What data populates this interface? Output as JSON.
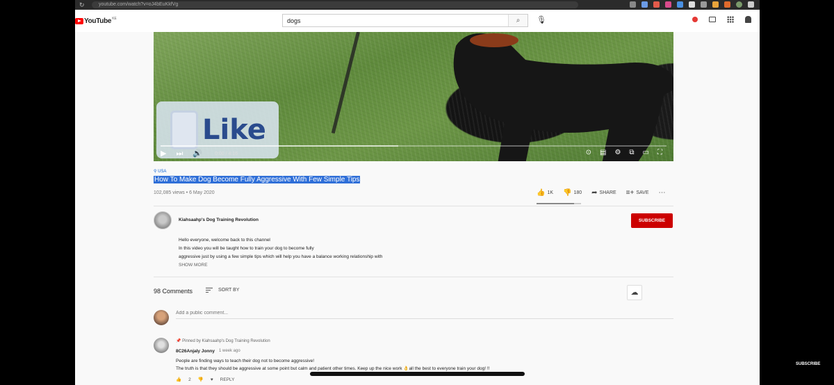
{
  "browser": {
    "url": "youtube.com/watch?v=oJ4bEuKkfVg"
  },
  "header": {
    "logo": "YouTube",
    "region": "KE",
    "search_value": "dogs",
    "search_placeholder": "Search"
  },
  "player": {
    "overlay_text": "Like",
    "time": "0:00 / 4:16",
    "progress_fraction": 0.0,
    "loaded_fraction": 0.47
  },
  "video": {
    "location": "USA",
    "title": "How To Make Dog Become Fully Aggressive With Few Simple Tips",
    "meta": "102,085 views • 6 May 2020",
    "likes": "1K",
    "dislikes": "180",
    "share_label": "SHARE",
    "save_label": "SAVE"
  },
  "channel": {
    "name": "Kiahsaahp's Dog Training Revolution",
    "subscribe_label": "SUBSCRIBE"
  },
  "description": {
    "line1": "Hello everyone, welcome back to this channel",
    "line2": "In this video you will be taught how to train your dog to become fully",
    "line3": "aggressive just by using a few simple tips which will help you have a balance working relationship with",
    "show_more": "SHOW MORE"
  },
  "comments": {
    "count_label": "98 Comments",
    "sort_label": "SORT BY",
    "add_placeholder": "Add a public comment...",
    "pinned_label": "Pinned by Kiahsaahp's Dog Training Revolution",
    "author": "8C26Anjaly Jonny",
    "time": "1 week ago",
    "text_line1": "People are finding ways to teach their dog not to become aggressive!",
    "text_line2": "The truth is that they should be aggressive at some point but calm and patient other times. Keep up the nice work 👌all the best to everyone train your dog! !!",
    "likes": "2",
    "reply_label": "REPLY"
  },
  "watermark": "SUBSCRIBE"
}
